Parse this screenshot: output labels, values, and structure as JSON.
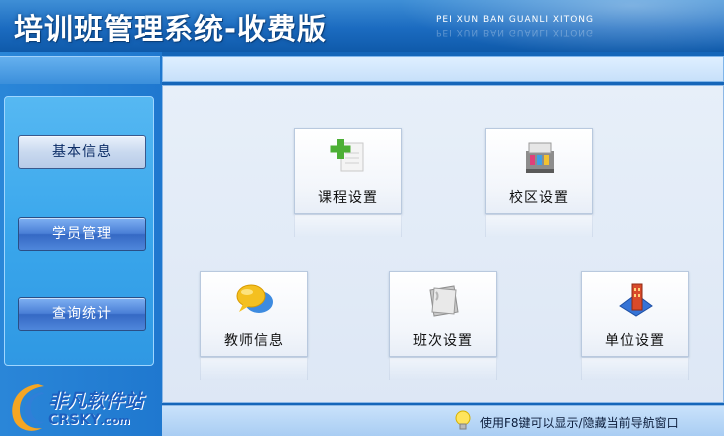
{
  "header": {
    "title": "培训班管理系统-收费版",
    "subtitle": "PEI XUN BAN GUANLI XITONG"
  },
  "sidebar": {
    "items": [
      {
        "label": "基本信息",
        "active": true
      },
      {
        "label": "学员管理",
        "active": false
      },
      {
        "label": "查询统计",
        "active": false
      }
    ]
  },
  "logo": {
    "text_cn": "非凡软件站",
    "text_en": "CRSKY",
    "text_en_suffix": ".com"
  },
  "tiles": [
    {
      "label": "课程设置",
      "icon": "course-add-icon"
    },
    {
      "label": "校区设置",
      "icon": "campus-icon"
    },
    {
      "label": "教师信息",
      "icon": "teacher-chat-icon"
    },
    {
      "label": "班次设置",
      "icon": "class-folder-icon"
    },
    {
      "label": "单位设置",
      "icon": "organization-icon"
    }
  ],
  "status": {
    "hint": "使用F8键可以显示/隐藏当前导航窗口",
    "icon": "lightbulb-icon"
  },
  "colors": {
    "header_blue": "#1b6bc0",
    "nav_button_blue": "#4a7fd6",
    "content_bg": "#e7eff9"
  }
}
